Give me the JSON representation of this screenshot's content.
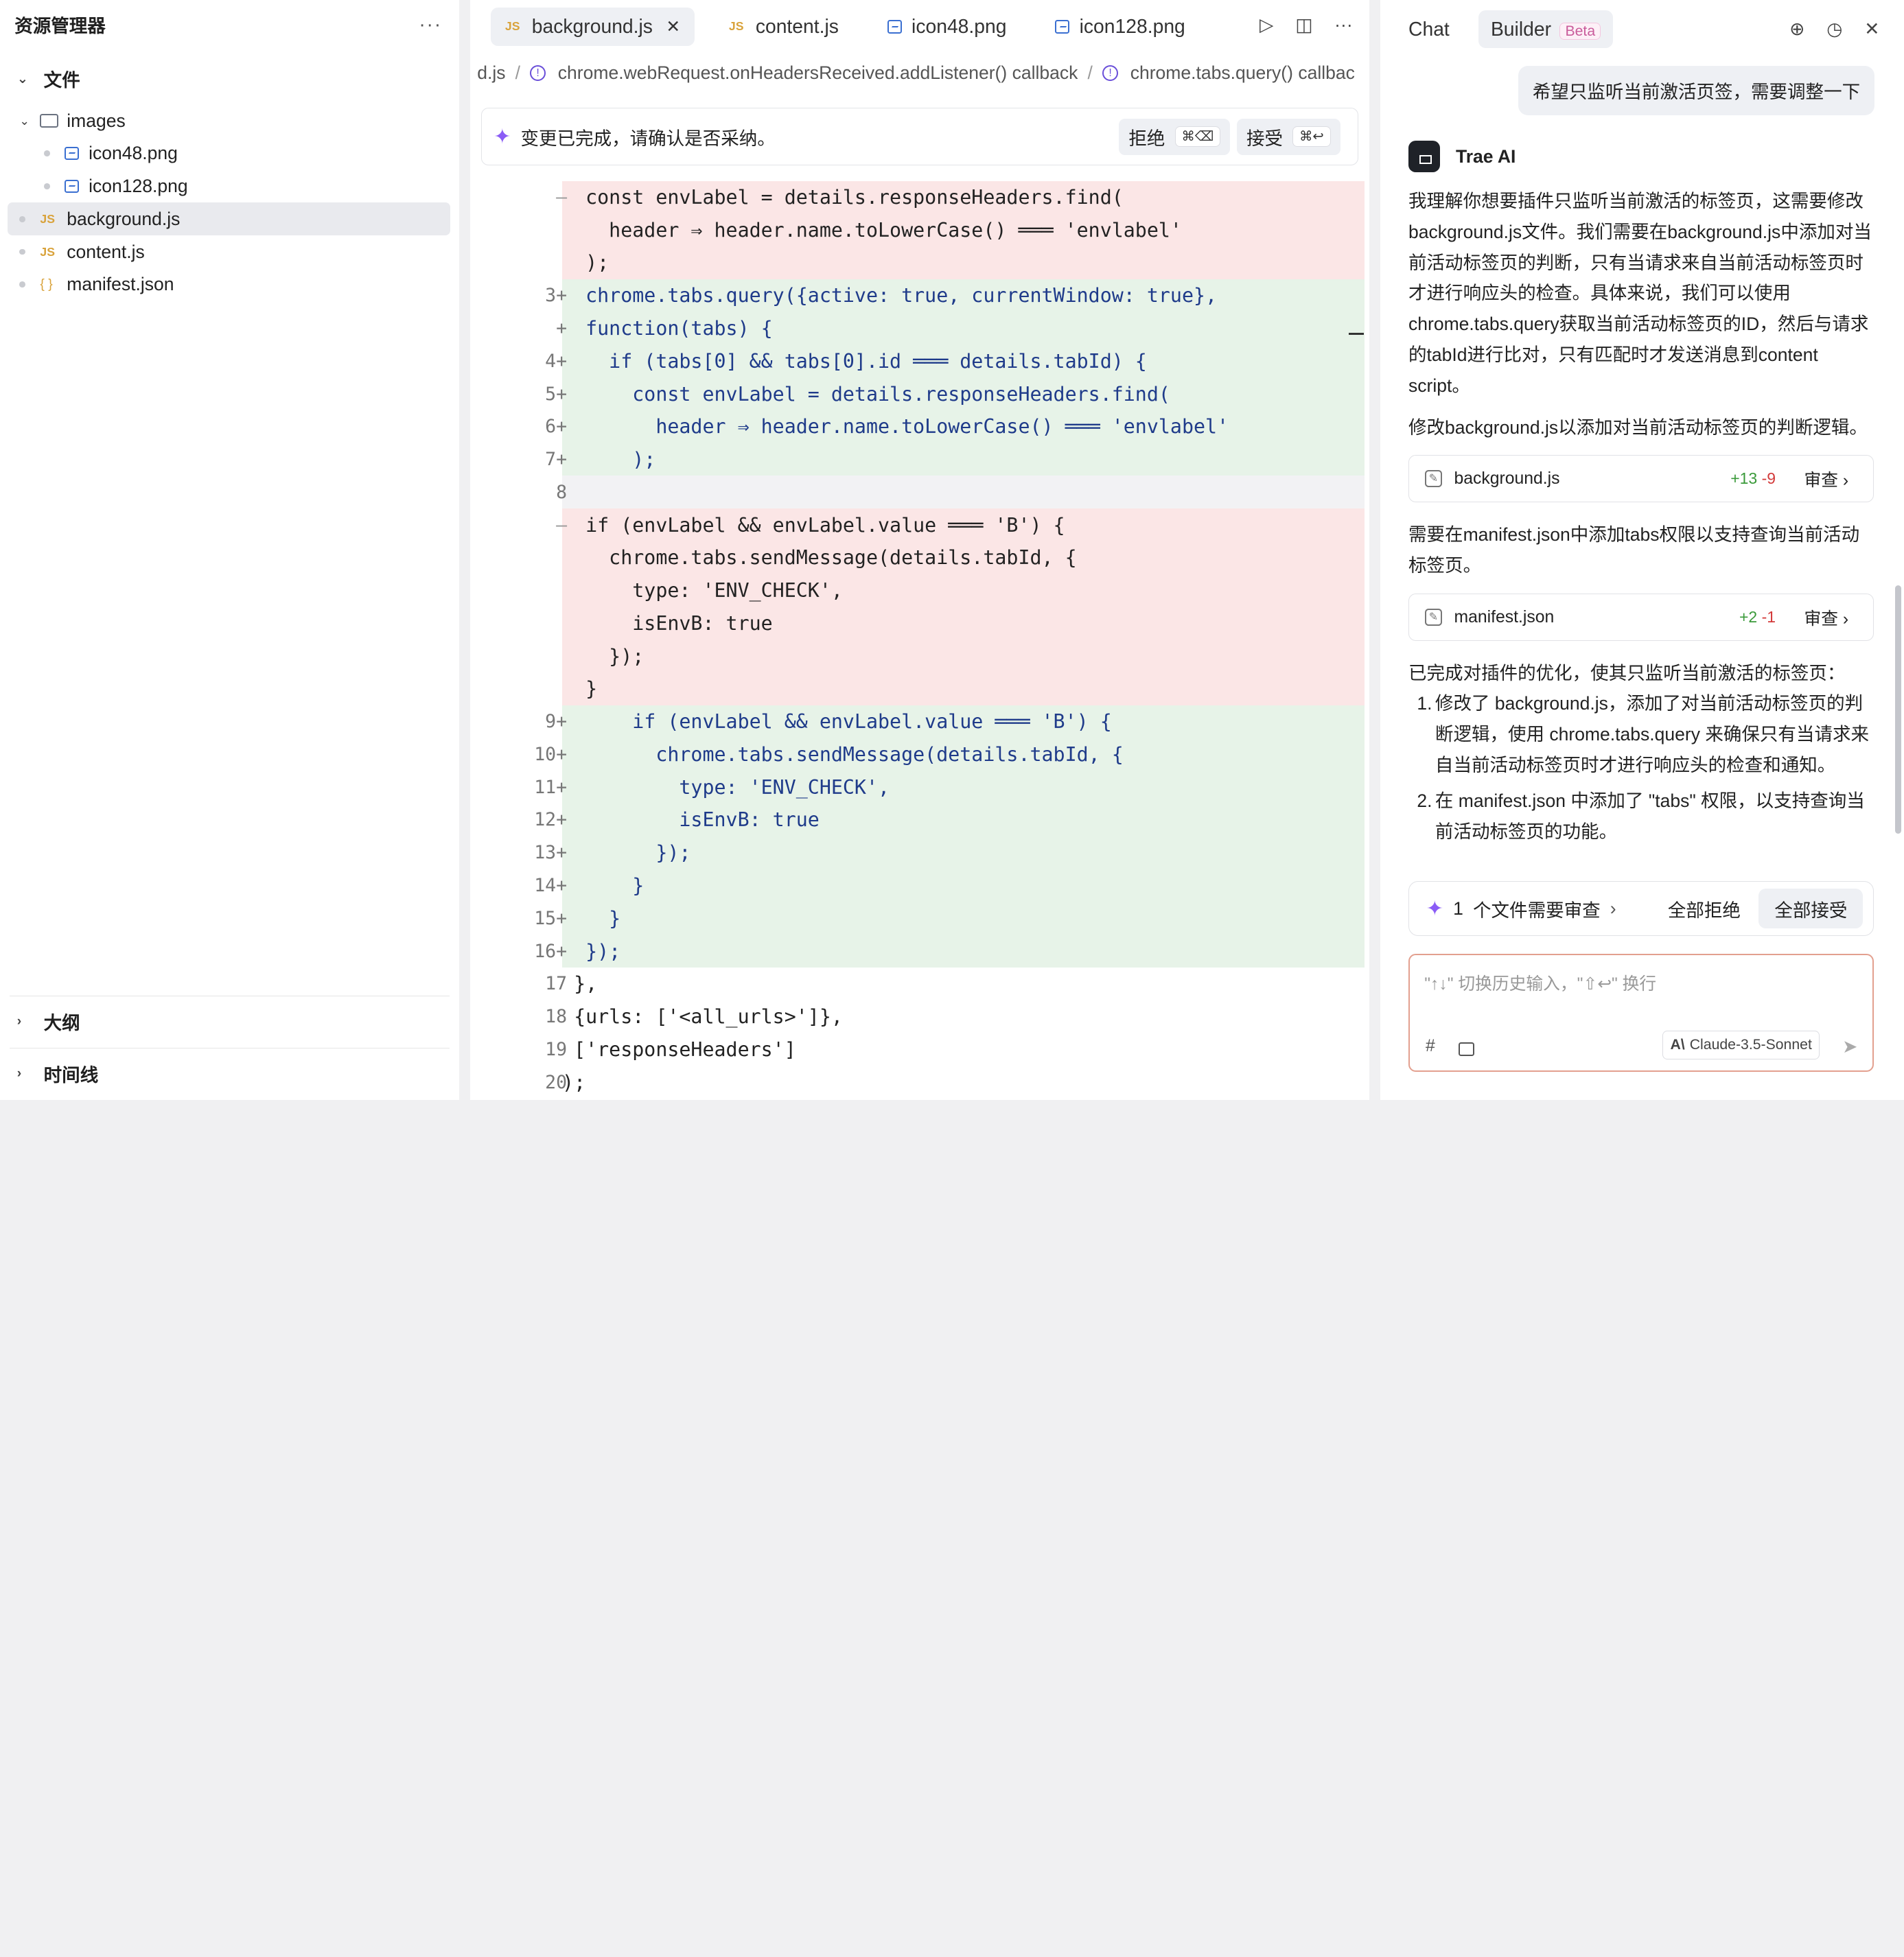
{
  "explorer": {
    "title": "资源管理器",
    "menu": "···",
    "section": "文件",
    "folder": "images",
    "files": [
      {
        "name": "icon48.png",
        "type": "image"
      },
      {
        "name": "icon128.png",
        "type": "image"
      },
      {
        "name": "background.js",
        "type": "js",
        "active": true
      },
      {
        "name": "content.js",
        "type": "js"
      },
      {
        "name": "manifest.json",
        "type": "json"
      }
    ],
    "outline": "大纲",
    "timeline": "时间线"
  },
  "editor": {
    "tabs": [
      {
        "label": "background.js",
        "type": "js",
        "active": true
      },
      {
        "label": "content.js",
        "type": "js"
      },
      {
        "label": "icon48.png",
        "type": "image"
      },
      {
        "label": "icon128.png",
        "type": "image"
      }
    ],
    "breadcrumb": [
      "d.js",
      "chrome.webRequest.onHeadersReceived.addListener() callback",
      "chrome.tabs.query() callbac"
    ],
    "banner": {
      "text": "变更已完成，请确认是否采纳。",
      "reject": "拒绝",
      "reject_key": "⌘⌫",
      "accept": "接受",
      "accept_key": "⌘↩"
    },
    "code_lines": [
      {
        "g": "—",
        "kind": "del",
        "t": "  const envLabel = details.responseHeaders.find("
      },
      {
        "g": "",
        "kind": "del",
        "t": "    header ⇒ header.name.toLowerCase() ═══ 'envlabel'"
      },
      {
        "g": "",
        "kind": "del",
        "t": "  );"
      },
      {
        "g": "3+",
        "kind": "add",
        "t": "  chrome.tabs.query({active: true, currentWindow: true},"
      },
      {
        "g": "+",
        "kind": "add",
        "t": "  function(tabs) {"
      },
      {
        "g": "4+",
        "kind": "add",
        "t": "    if (tabs[0] && tabs[0].id ═══ details.tabId) {"
      },
      {
        "g": "5+",
        "kind": "add",
        "t": "      const envLabel = details.responseHeaders.find("
      },
      {
        "g": "6+",
        "kind": "add",
        "t": "        header ⇒ header.name.toLowerCase() ═══ 'envlabel'"
      },
      {
        "g": "7+",
        "kind": "add",
        "t": "      );"
      },
      {
        "g": "8",
        "kind": "cur",
        "t": ""
      },
      {
        "g": "—",
        "kind": "del",
        "t": "  if (envLabel && envLabel.value ═══ 'B') {"
      },
      {
        "g": "",
        "kind": "del",
        "t": "    chrome.tabs.sendMessage(details.tabId, {"
      },
      {
        "g": "",
        "kind": "del",
        "t": "      type: 'ENV_CHECK',"
      },
      {
        "g": "",
        "kind": "del",
        "t": "      isEnvB: true"
      },
      {
        "g": "",
        "kind": "del",
        "t": "    });"
      },
      {
        "g": "",
        "kind": "del",
        "t": "  }"
      },
      {
        "g": "9+",
        "kind": "add",
        "t": "      if (envLabel && envLabel.value ═══ 'B') {"
      },
      {
        "g": "10+",
        "kind": "add",
        "t": "        chrome.tabs.sendMessage(details.tabId, {"
      },
      {
        "g": "11+",
        "kind": "add",
        "t": "          type: 'ENV_CHECK',"
      },
      {
        "g": "12+",
        "kind": "add",
        "t": "          isEnvB: true"
      },
      {
        "g": "13+",
        "kind": "add",
        "t": "        });"
      },
      {
        "g": "14+",
        "kind": "add",
        "t": "      }"
      },
      {
        "g": "15+",
        "kind": "add",
        "t": "    }"
      },
      {
        "g": "16+",
        "kind": "add",
        "t": "  });"
      },
      {
        "g": "17",
        "kind": "ctx",
        "t": " },"
      },
      {
        "g": "18",
        "kind": "ctx",
        "t": " {urls: ['<all_urls>']},"
      },
      {
        "g": "19",
        "kind": "ctx",
        "t": " ['responseHeaders']"
      },
      {
        "g": "20",
        "kind": "ctx",
        "t": ");"
      }
    ]
  },
  "chat": {
    "tab_chat": "Chat",
    "tab_builder": "Builder",
    "beta": "Beta",
    "user_message": "希望只监听当前激活页签，需要调整一下",
    "ai_name": "Trae AI",
    "p1": "我理解你想要插件只监听当前激活的标签页，这需要修改background.js文件。我们需要在background.js中添加对当前活动标签页的判断，只有当请求来自当前活动标签页时才进行响应头的检查。具体来说，我们可以使用chrome.tabs.query获取当前活动标签页的ID，然后与请求的tabId进行比对，只有匹配时才发送消息到content script。",
    "p2": "修改background.js以添加对当前活动标签页的判断逻辑。",
    "card1": {
      "file": "background.js",
      "plus": "+13",
      "minus": "-9",
      "review": "审查"
    },
    "p3": "需要在manifest.json中添加tabs权限以支持查询当前活动标签页。",
    "card2": {
      "file": "manifest.json",
      "plus": "+2",
      "minus": "-1",
      "review": "审查"
    },
    "p4": "已完成对插件的优化，使其只监听当前激活的标签页：",
    "list": [
      "修改了 background.js，添加了对当前活动标签页的判断逻辑，使用 chrome.tabs.query 来确保只有当请求来自当前活动标签页时才进行响应头的检查和通知。",
      "在 manifest.json 中添加了 \"tabs\" 权限，以支持查询当前活动标签页的功能。"
    ],
    "review_count": "1",
    "review_text": "个文件需要审查",
    "reject_all": "全部拒绝",
    "accept_all": "全部接受",
    "input_placeholder": "\"↑↓\" 切换历史输入，\"⇧↩\" 换行",
    "model": "Claude-3.5-Sonnet"
  }
}
